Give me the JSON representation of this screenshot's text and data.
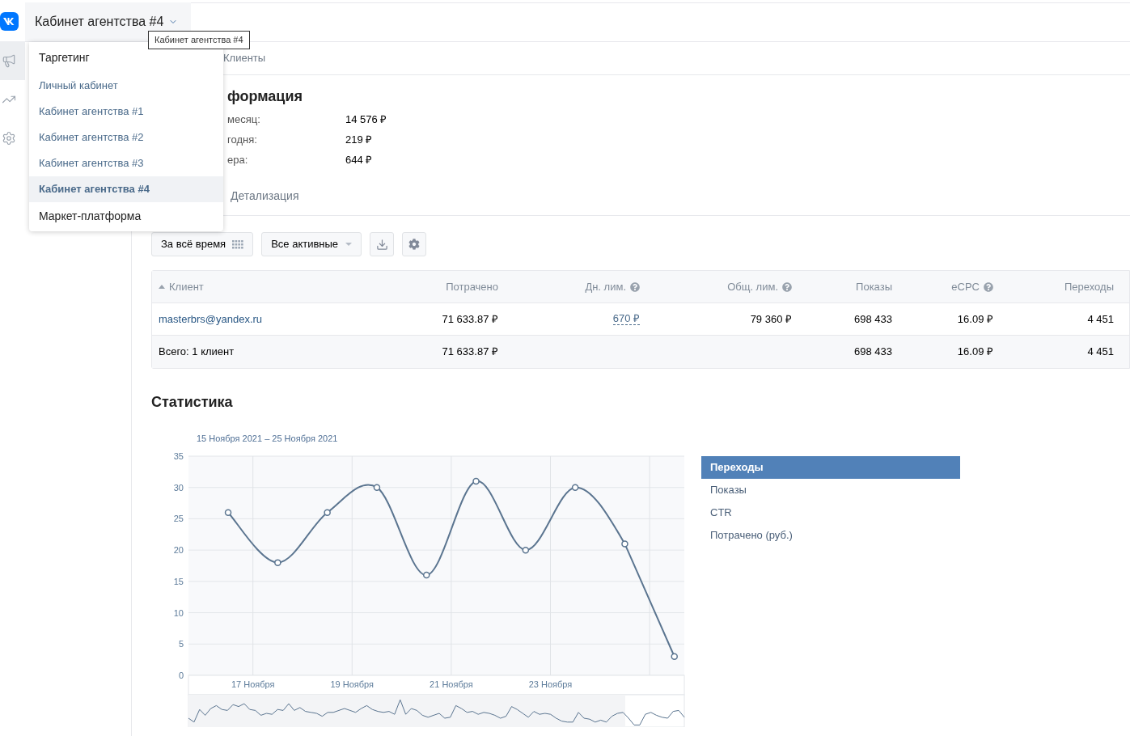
{
  "header": {
    "title": "Кабинет агентства #4",
    "tooltip": "Кабинет агентства #4"
  },
  "rail": [
    {
      "selected": true
    },
    {
      "selected": false
    },
    {
      "selected": false
    }
  ],
  "dropdown": [
    {
      "label": "Таргетинг",
      "kind": "section",
      "selected": false
    },
    {
      "label": "Личный кабинет",
      "kind": "account",
      "selected": false
    },
    {
      "label": "Кабинет агентства #1",
      "kind": "account",
      "selected": false
    },
    {
      "label": "Кабинет агентства #2",
      "kind": "account",
      "selected": false
    },
    {
      "label": "Кабинет агентства #3",
      "kind": "account",
      "selected": false
    },
    {
      "label": "Кабинет агентства #4",
      "kind": "account",
      "selected": true
    },
    {
      "label": "Маркет-платформа",
      "kind": "section",
      "selected": false
    }
  ],
  "top_tab": "Клиенты",
  "info": {
    "title": "формация",
    "rows": [
      {
        "label": "месяц:",
        "value": "14 576 ₽"
      },
      {
        "label": "годня:",
        "value": "219 ₽"
      },
      {
        "label": "ера:",
        "value": "644 ₽"
      }
    ]
  },
  "sub_tab": "Детализация",
  "toolbar": {
    "period": "За всё время",
    "filter": "Все активные"
  },
  "table": {
    "columns": [
      {
        "label": "Клиент",
        "help": false,
        "sorted": true
      },
      {
        "label": "Потрачено",
        "help": false,
        "sorted": false
      },
      {
        "label": "Дн. лим.",
        "help": true,
        "sorted": false
      },
      {
        "label": "Общ. лим.",
        "help": true,
        "sorted": false
      },
      {
        "label": "Показы",
        "help": false,
        "sorted": false
      },
      {
        "label": "eCPC",
        "help": true,
        "sorted": false
      },
      {
        "label": "Переходы",
        "help": false,
        "sorted": false
      }
    ],
    "rows": [
      {
        "kind": "client",
        "cells": [
          "masterbrs@yandex.ru",
          "71 633.87 ₽",
          "670 ₽",
          "79 360 ₽",
          "698 433",
          "16.09 ₽",
          "4 451"
        ]
      },
      {
        "kind": "total",
        "cells": [
          "Всего: 1 клиент",
          "71 633.87 ₽",
          "",
          "",
          "698 433",
          "16.09 ₽",
          "4 451"
        ]
      }
    ]
  },
  "stats": {
    "title": "Статистика",
    "chart_data": {
      "type": "line",
      "title": "15 Ноября 2021 – 25 Ноября 2021",
      "x": [
        16.5,
        17.5,
        18.5,
        19.5,
        20.5,
        21.5,
        22.5,
        23.5,
        24.5,
        25.5
      ],
      "series": [
        {
          "color": "#5b7590",
          "marker": "circle",
          "values": [
            26,
            18,
            26,
            30,
            16,
            31,
            20,
            30,
            21,
            3
          ]
        }
      ],
      "xlim": [
        15.7,
        25.7
      ],
      "ylim": [
        0,
        35
      ],
      "grid": true,
      "xticks": [
        {
          "value": 17,
          "label": "17 Ноября"
        },
        {
          "value": 19,
          "label": "19 Ноября"
        },
        {
          "value": 21,
          "label": "21 Ноября"
        },
        {
          "value": 23,
          "label": "23 Ноября"
        }
      ],
      "yticks": [
        0,
        5,
        10,
        15,
        20,
        25,
        30,
        35
      ]
    },
    "legend": [
      {
        "label": "Переходы",
        "selected": true
      },
      {
        "label": "Показы",
        "selected": false
      },
      {
        "label": "CTR",
        "selected": false
      },
      {
        "label": "Потрачено (руб.)",
        "selected": false
      }
    ]
  }
}
